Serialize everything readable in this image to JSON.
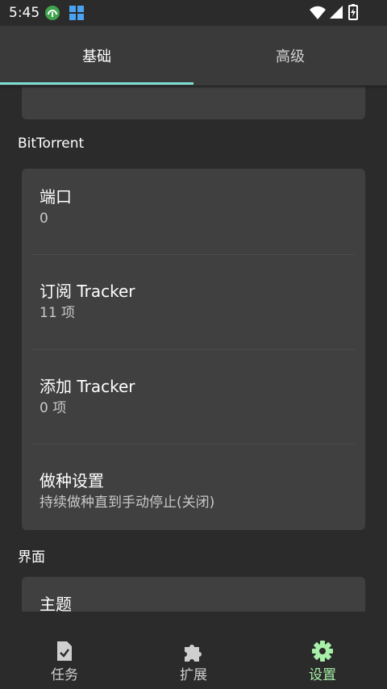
{
  "status_bar": {
    "time": "5:45"
  },
  "tabs": [
    {
      "label": "基础"
    },
    {
      "label": "高级"
    }
  ],
  "sections": {
    "bittorrent": {
      "title": "BitTorrent",
      "items": [
        {
          "title": "端口",
          "subtitle": "0"
        },
        {
          "title": "订阅 Tracker",
          "subtitle": "11 项"
        },
        {
          "title": "添加 Tracker",
          "subtitle": "0 项"
        },
        {
          "title": "做种设置",
          "subtitle": "持续做种直到手动停止(关闭)"
        }
      ]
    },
    "interface": {
      "title": "界面",
      "items": [
        {
          "title": "主题"
        }
      ]
    }
  },
  "bottom_nav": [
    {
      "label": "任务",
      "icon": "task-icon"
    },
    {
      "label": "扩展",
      "icon": "puzzle-icon"
    },
    {
      "label": "设置",
      "icon": "gear-icon",
      "active": true
    }
  ],
  "colors": {
    "accent_tab": "#7ee0d4",
    "accent_nav": "#a8f0a8",
    "card": "#404040",
    "background": "#2b2b2b",
    "tabbar": "#3a3a3a"
  }
}
